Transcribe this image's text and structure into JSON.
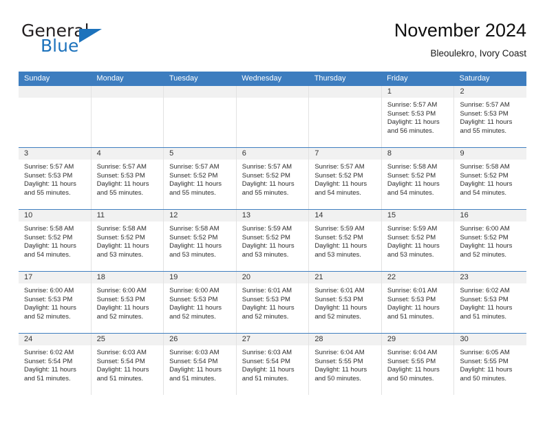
{
  "brand": {
    "word1": "General",
    "word2": "Blue",
    "triangle_color": "#1c72bc",
    "icon": "triangle-icon"
  },
  "header": {
    "title": "November 2024",
    "subtitle": "Bleoulekro, Ivory Coast"
  },
  "theme": {
    "header_blue": "#3d7dbf",
    "daynum_bg": "#f1f1f1",
    "grid_line": "#e2e2e2"
  },
  "weekday_headers": [
    "Sunday",
    "Monday",
    "Tuesday",
    "Wednesday",
    "Thursday",
    "Friday",
    "Saturday"
  ],
  "weeks": [
    [
      {
        "day": "",
        "empty": true,
        "sunrise": "",
        "sunset": "",
        "daylight1": "",
        "daylight2": ""
      },
      {
        "day": "",
        "empty": true,
        "sunrise": "",
        "sunset": "",
        "daylight1": "",
        "daylight2": ""
      },
      {
        "day": "",
        "empty": true,
        "sunrise": "",
        "sunset": "",
        "daylight1": "",
        "daylight2": ""
      },
      {
        "day": "",
        "empty": true,
        "sunrise": "",
        "sunset": "",
        "daylight1": "",
        "daylight2": ""
      },
      {
        "day": "",
        "empty": true,
        "sunrise": "",
        "sunset": "",
        "daylight1": "",
        "daylight2": ""
      },
      {
        "day": "1",
        "sunrise": "Sunrise: 5:57 AM",
        "sunset": "Sunset: 5:53 PM",
        "daylight1": "Daylight: 11 hours",
        "daylight2": "and 56 minutes."
      },
      {
        "day": "2",
        "sunrise": "Sunrise: 5:57 AM",
        "sunset": "Sunset: 5:53 PM",
        "daylight1": "Daylight: 11 hours",
        "daylight2": "and 55 minutes."
      }
    ],
    [
      {
        "day": "3",
        "sunrise": "Sunrise: 5:57 AM",
        "sunset": "Sunset: 5:53 PM",
        "daylight1": "Daylight: 11 hours",
        "daylight2": "and 55 minutes."
      },
      {
        "day": "4",
        "sunrise": "Sunrise: 5:57 AM",
        "sunset": "Sunset: 5:53 PM",
        "daylight1": "Daylight: 11 hours",
        "daylight2": "and 55 minutes."
      },
      {
        "day": "5",
        "sunrise": "Sunrise: 5:57 AM",
        "sunset": "Sunset: 5:52 PM",
        "daylight1": "Daylight: 11 hours",
        "daylight2": "and 55 minutes."
      },
      {
        "day": "6",
        "sunrise": "Sunrise: 5:57 AM",
        "sunset": "Sunset: 5:52 PM",
        "daylight1": "Daylight: 11 hours",
        "daylight2": "and 55 minutes."
      },
      {
        "day": "7",
        "sunrise": "Sunrise: 5:57 AM",
        "sunset": "Sunset: 5:52 PM",
        "daylight1": "Daylight: 11 hours",
        "daylight2": "and 54 minutes."
      },
      {
        "day": "8",
        "sunrise": "Sunrise: 5:58 AM",
        "sunset": "Sunset: 5:52 PM",
        "daylight1": "Daylight: 11 hours",
        "daylight2": "and 54 minutes."
      },
      {
        "day": "9",
        "sunrise": "Sunrise: 5:58 AM",
        "sunset": "Sunset: 5:52 PM",
        "daylight1": "Daylight: 11 hours",
        "daylight2": "and 54 minutes."
      }
    ],
    [
      {
        "day": "10",
        "sunrise": "Sunrise: 5:58 AM",
        "sunset": "Sunset: 5:52 PM",
        "daylight1": "Daylight: 11 hours",
        "daylight2": "and 54 minutes."
      },
      {
        "day": "11",
        "sunrise": "Sunrise: 5:58 AM",
        "sunset": "Sunset: 5:52 PM",
        "daylight1": "Daylight: 11 hours",
        "daylight2": "and 53 minutes."
      },
      {
        "day": "12",
        "sunrise": "Sunrise: 5:58 AM",
        "sunset": "Sunset: 5:52 PM",
        "daylight1": "Daylight: 11 hours",
        "daylight2": "and 53 minutes."
      },
      {
        "day": "13",
        "sunrise": "Sunrise: 5:59 AM",
        "sunset": "Sunset: 5:52 PM",
        "daylight1": "Daylight: 11 hours",
        "daylight2": "and 53 minutes."
      },
      {
        "day": "14",
        "sunrise": "Sunrise: 5:59 AM",
        "sunset": "Sunset: 5:52 PM",
        "daylight1": "Daylight: 11 hours",
        "daylight2": "and 53 minutes."
      },
      {
        "day": "15",
        "sunrise": "Sunrise: 5:59 AM",
        "sunset": "Sunset: 5:52 PM",
        "daylight1": "Daylight: 11 hours",
        "daylight2": "and 53 minutes."
      },
      {
        "day": "16",
        "sunrise": "Sunrise: 6:00 AM",
        "sunset": "Sunset: 5:52 PM",
        "daylight1": "Daylight: 11 hours",
        "daylight2": "and 52 minutes."
      }
    ],
    [
      {
        "day": "17",
        "sunrise": "Sunrise: 6:00 AM",
        "sunset": "Sunset: 5:53 PM",
        "daylight1": "Daylight: 11 hours",
        "daylight2": "and 52 minutes."
      },
      {
        "day": "18",
        "sunrise": "Sunrise: 6:00 AM",
        "sunset": "Sunset: 5:53 PM",
        "daylight1": "Daylight: 11 hours",
        "daylight2": "and 52 minutes."
      },
      {
        "day": "19",
        "sunrise": "Sunrise: 6:00 AM",
        "sunset": "Sunset: 5:53 PM",
        "daylight1": "Daylight: 11 hours",
        "daylight2": "and 52 minutes."
      },
      {
        "day": "20",
        "sunrise": "Sunrise: 6:01 AM",
        "sunset": "Sunset: 5:53 PM",
        "daylight1": "Daylight: 11 hours",
        "daylight2": "and 52 minutes."
      },
      {
        "day": "21",
        "sunrise": "Sunrise: 6:01 AM",
        "sunset": "Sunset: 5:53 PM",
        "daylight1": "Daylight: 11 hours",
        "daylight2": "and 52 minutes."
      },
      {
        "day": "22",
        "sunrise": "Sunrise: 6:01 AM",
        "sunset": "Sunset: 5:53 PM",
        "daylight1": "Daylight: 11 hours",
        "daylight2": "and 51 minutes."
      },
      {
        "day": "23",
        "sunrise": "Sunrise: 6:02 AM",
        "sunset": "Sunset: 5:53 PM",
        "daylight1": "Daylight: 11 hours",
        "daylight2": "and 51 minutes."
      }
    ],
    [
      {
        "day": "24",
        "sunrise": "Sunrise: 6:02 AM",
        "sunset": "Sunset: 5:54 PM",
        "daylight1": "Daylight: 11 hours",
        "daylight2": "and 51 minutes."
      },
      {
        "day": "25",
        "sunrise": "Sunrise: 6:03 AM",
        "sunset": "Sunset: 5:54 PM",
        "daylight1": "Daylight: 11 hours",
        "daylight2": "and 51 minutes."
      },
      {
        "day": "26",
        "sunrise": "Sunrise: 6:03 AM",
        "sunset": "Sunset: 5:54 PM",
        "daylight1": "Daylight: 11 hours",
        "daylight2": "and 51 minutes."
      },
      {
        "day": "27",
        "sunrise": "Sunrise: 6:03 AM",
        "sunset": "Sunset: 5:54 PM",
        "daylight1": "Daylight: 11 hours",
        "daylight2": "and 51 minutes."
      },
      {
        "day": "28",
        "sunrise": "Sunrise: 6:04 AM",
        "sunset": "Sunset: 5:55 PM",
        "daylight1": "Daylight: 11 hours",
        "daylight2": "and 50 minutes."
      },
      {
        "day": "29",
        "sunrise": "Sunrise: 6:04 AM",
        "sunset": "Sunset: 5:55 PM",
        "daylight1": "Daylight: 11 hours",
        "daylight2": "and 50 minutes."
      },
      {
        "day": "30",
        "sunrise": "Sunrise: 6:05 AM",
        "sunset": "Sunset: 5:55 PM",
        "daylight1": "Daylight: 11 hours",
        "daylight2": "and 50 minutes."
      }
    ]
  ]
}
